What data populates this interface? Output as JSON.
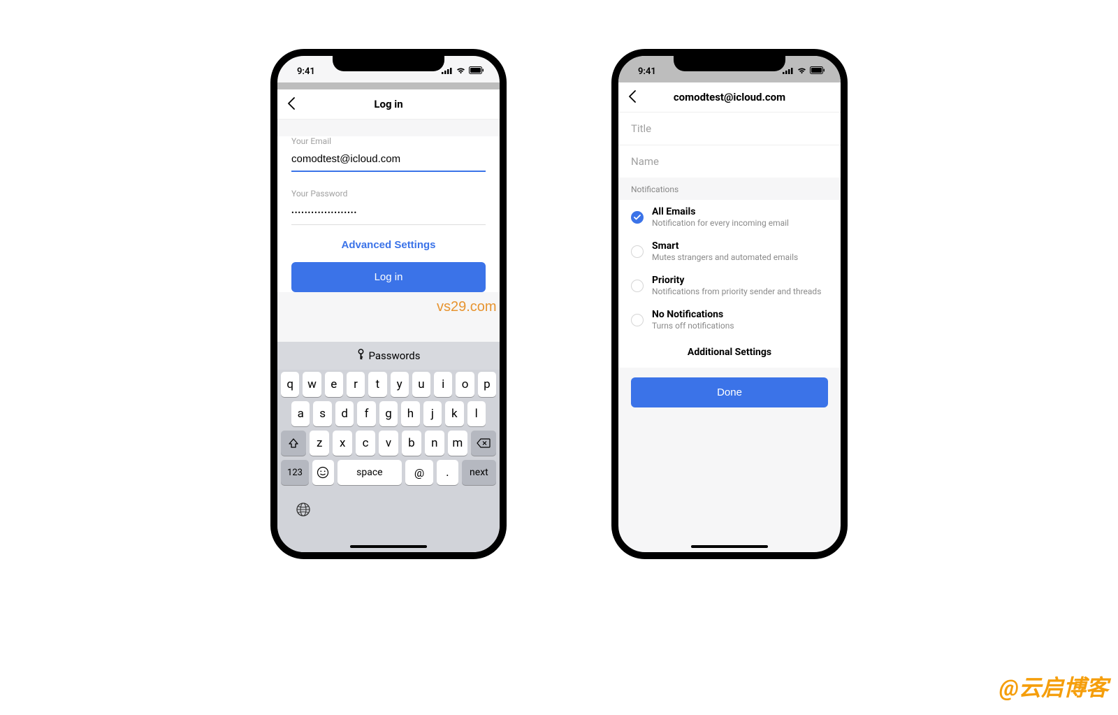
{
  "watermark_center": "vs29.com",
  "watermark_corner": "@云启博客",
  "status": {
    "time": "9:41"
  },
  "phone1": {
    "nav_title": "Log in",
    "email_label": "Your Email",
    "email_value": "comodtest@icloud.com",
    "password_label": "Your Password",
    "password_value": "••••••••••••••••••••",
    "advanced_settings": "Advanced Settings",
    "login_button": "Log in",
    "passwords_suggestion": "Passwords",
    "keyboard": {
      "row1": [
        "q",
        "w",
        "e",
        "r",
        "t",
        "y",
        "u",
        "i",
        "o",
        "p"
      ],
      "row2": [
        "a",
        "s",
        "d",
        "f",
        "g",
        "h",
        "j",
        "k",
        "l"
      ],
      "row3": [
        "z",
        "x",
        "c",
        "v",
        "b",
        "n",
        "m"
      ],
      "num_key": "123",
      "space_key": "space",
      "at_key": "@",
      "dot_key": ".",
      "next_key": "next"
    }
  },
  "phone2": {
    "nav_title": "comodtest@icloud.com",
    "title_placeholder": "Title",
    "name_placeholder": "Name",
    "notifications_header": "Notifications",
    "options": [
      {
        "title": "All Emails",
        "sub": "Notification for every incoming email",
        "selected": true
      },
      {
        "title": "Smart",
        "sub": "Mutes strangers and automated emails",
        "selected": false
      },
      {
        "title": "Priority",
        "sub": "Notifications from priority sender and threads",
        "selected": false
      },
      {
        "title": "No Notifications",
        "sub": "Turns off notifications",
        "selected": false
      }
    ],
    "additional_settings": "Additional Settings",
    "done_button": "Done"
  }
}
